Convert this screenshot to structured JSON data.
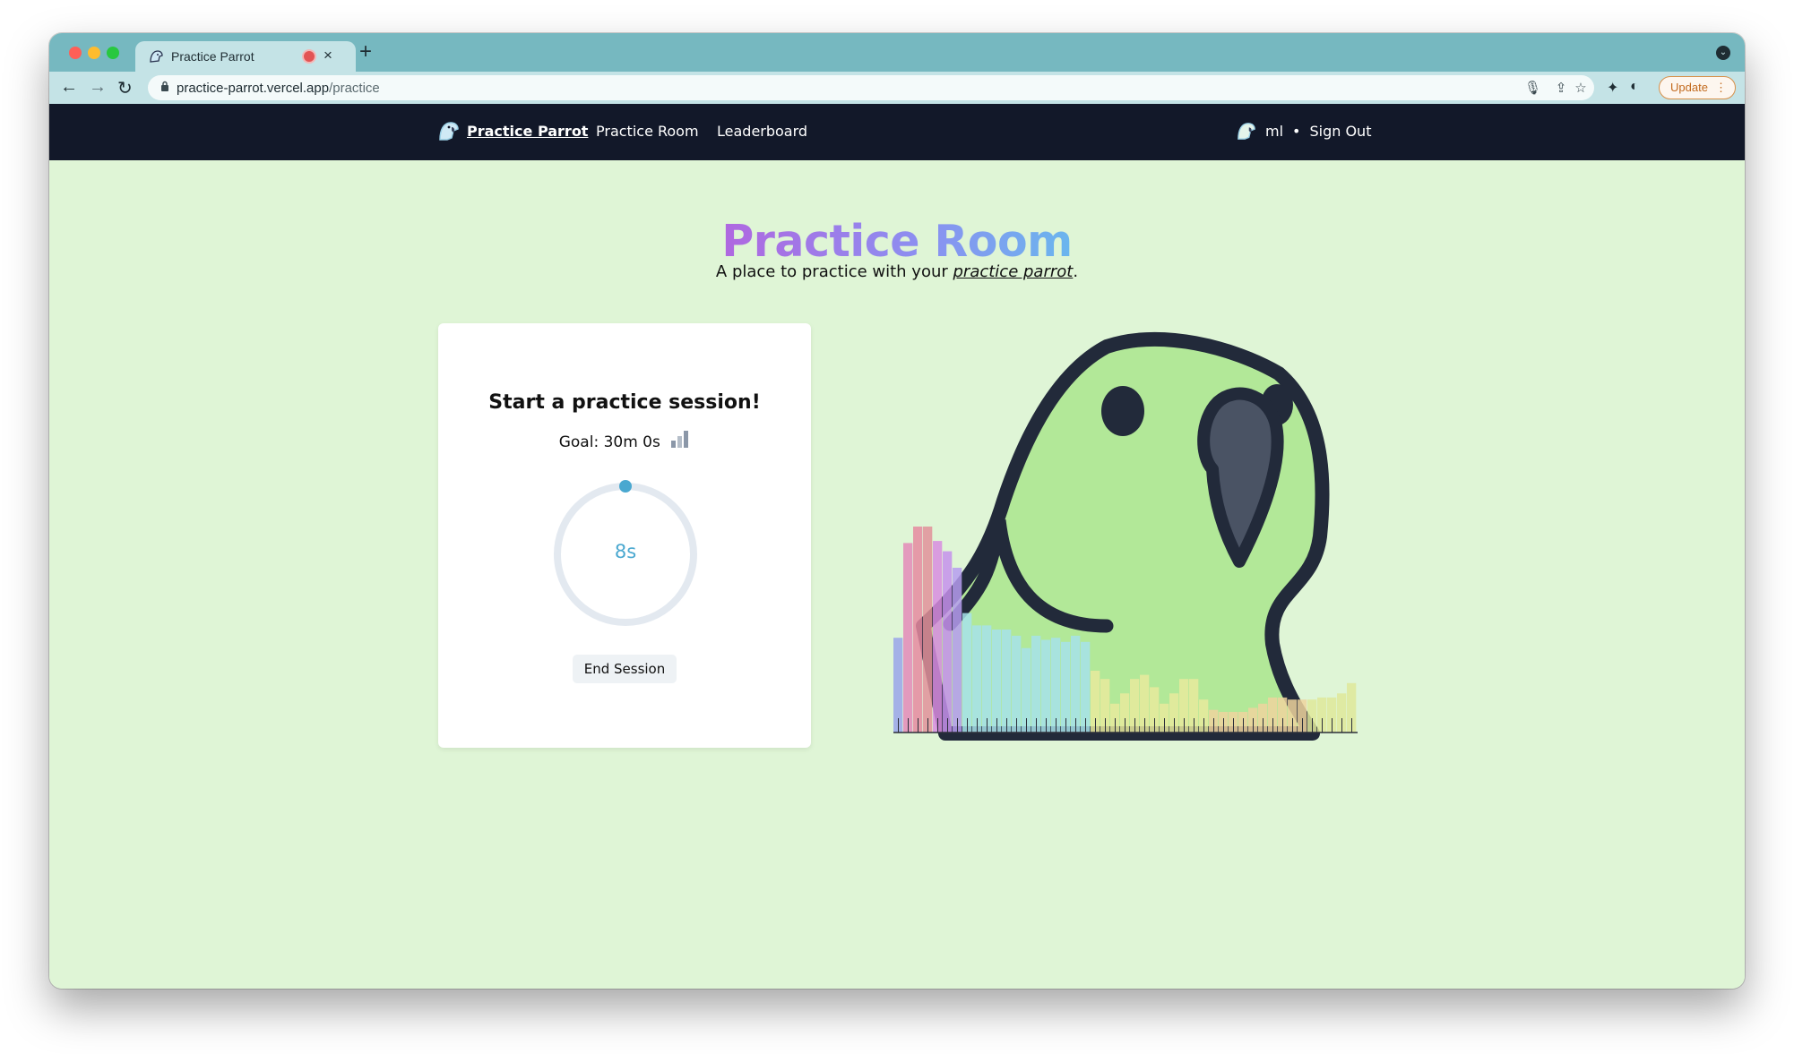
{
  "browser": {
    "tab_title": "Practice Parrot",
    "tab_close": "×",
    "new_tab": "+",
    "url_host": "practice-parrot.vercel.app",
    "url_path": "/practice",
    "update_label": "Update"
  },
  "nav": {
    "brand": "Practice Parrot",
    "links": [
      "Practice Room",
      "Leaderboard"
    ],
    "username": "ml",
    "separator": "•",
    "sign_out": "Sign Out"
  },
  "page": {
    "title": "Practice Room",
    "subtitle_prefix": "A place to practice with your ",
    "subtitle_emphasis": "practice parrot",
    "subtitle_suffix": "."
  },
  "session": {
    "heading": "Start a practice session!",
    "goal": "Goal: 30m 0s",
    "timer": "8s",
    "end_label": "End Session"
  },
  "colors": {
    "nav_bg": "#121829",
    "page_bg": "#dff5d6",
    "accent": "#4aa8d0",
    "parrot_green": "#b2e898",
    "parrot_outline": "#222a3a"
  },
  "visualizer_bars": [
    0.46,
    0.92,
    1.0,
    1.0,
    0.93,
    0.88,
    0.8,
    0.58,
    0.52,
    0.52,
    0.5,
    0.5,
    0.47,
    0.41,
    0.47,
    0.45,
    0.46,
    0.44,
    0.47,
    0.44,
    0.3,
    0.26,
    0.14,
    0.19,
    0.26,
    0.28,
    0.22,
    0.14,
    0.19,
    0.26,
    0.26,
    0.16,
    0.11,
    0.1,
    0.1,
    0.1,
    0.12,
    0.14,
    0.17,
    0.17,
    0.16,
    0.16,
    0.16,
    0.17,
    0.17,
    0.19,
    0.24
  ]
}
